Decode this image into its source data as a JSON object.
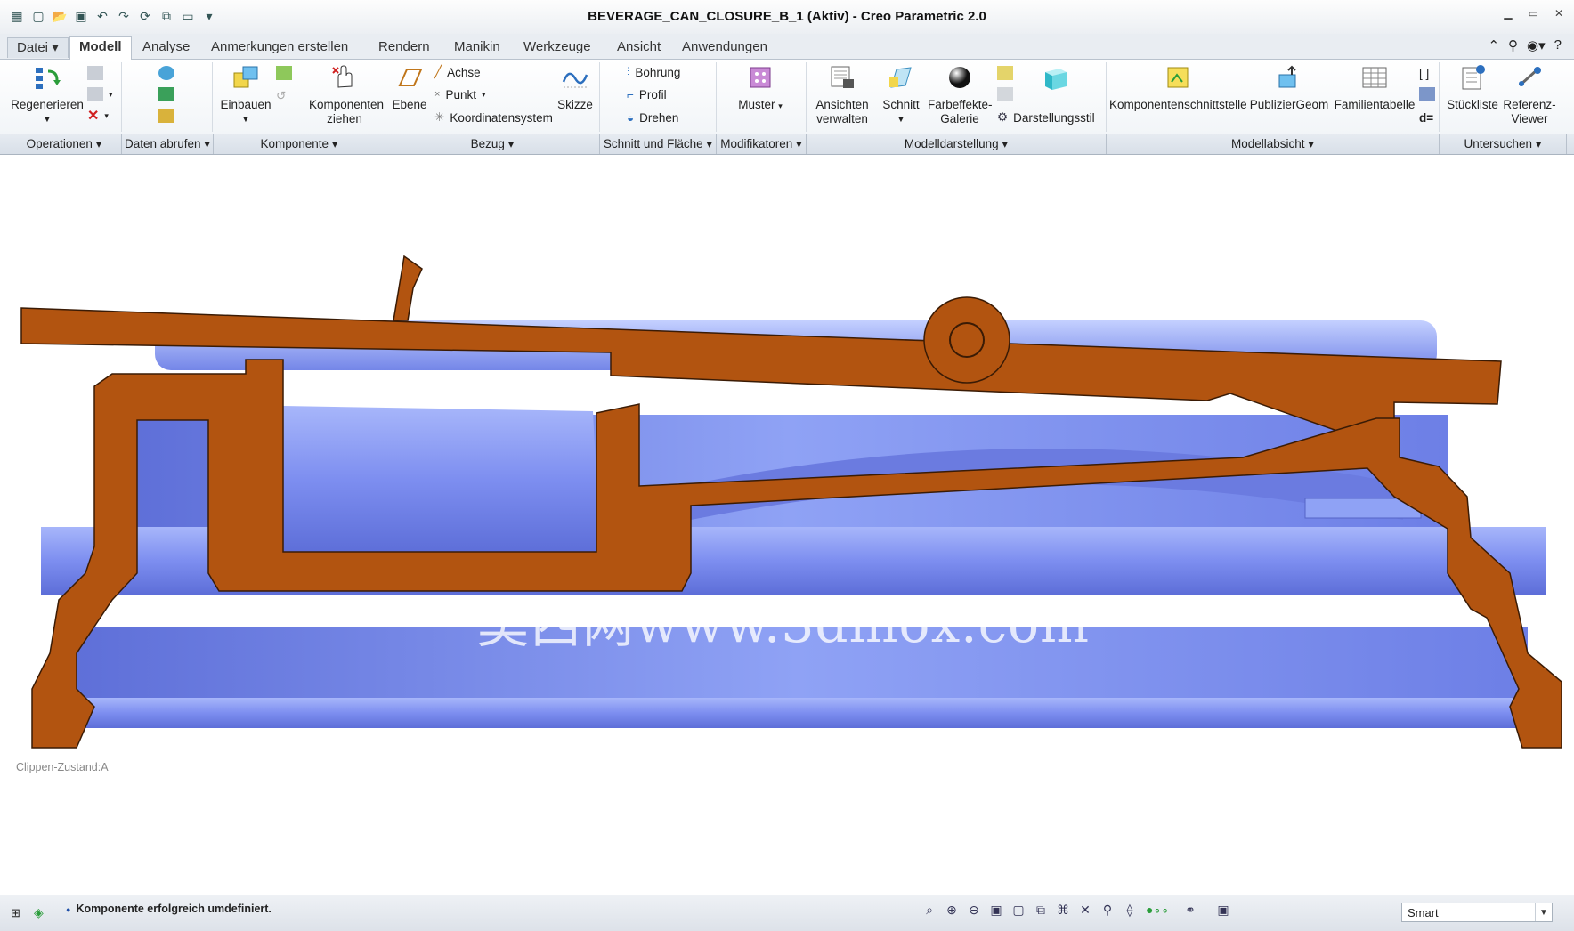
{
  "window": {
    "title": "BEVERAGE_CAN_CLOSURE_B_1 (Aktiv) - Creo Parametric 2.0"
  },
  "tabs": {
    "file": "Datei",
    "items": [
      "Modell",
      "Analyse",
      "Anmerkungen erstellen",
      "Rendern",
      "Manikin",
      "Werkzeuge",
      "Ansicht",
      "Anwendungen"
    ],
    "active": "Modell"
  },
  "ribbon": {
    "operations": {
      "regenerate": "Regenerieren"
    },
    "component": {
      "assemble": "Einbauen",
      "drag": "Komponenten ziehen"
    },
    "datum": {
      "plane": "Ebene",
      "axis": "Achse",
      "point": "Punkt",
      "csys": "Koordinatensystem",
      "sketch": "Skizze"
    },
    "cut_surface": {
      "hole": "Bohrung",
      "profile": "Profil",
      "revolve": "Drehen"
    },
    "modifiers": {
      "pattern": "Muster"
    },
    "display": {
      "manage_views": "Ansichten verwalten",
      "section": "Schnitt",
      "appearance": "Farbeffekte-Galerie",
      "display_style": "Darstellungsstil"
    },
    "model_intent": {
      "component_interface": "Komponentenschnittstelle",
      "publish_geom": "PublizierGeom",
      "family_table": "Familientabelle"
    },
    "investigate": {
      "bom": "Stückliste",
      "ref_viewer": "Referenz-Viewer",
      "relations": "d="
    }
  },
  "groups": [
    "Operationen",
    "Daten abrufen",
    "Komponente",
    "Bezug",
    "Schnitt und Fläche",
    "Modifikatoren",
    "Modelldarstellung",
    "Modellabsicht",
    "Untersuchen"
  ],
  "canvas": {
    "clip_state": "Clippen-Zustand:A",
    "watermark": "莫西网www.3dmox.com"
  },
  "status": {
    "message": "Komponente erfolgreich umdefiniert.",
    "filter": "Smart"
  },
  "colors": {
    "section_fill": "#b25410",
    "part_blue": "#7f8ff0",
    "ribbon_bg": "#f4f6f9"
  }
}
